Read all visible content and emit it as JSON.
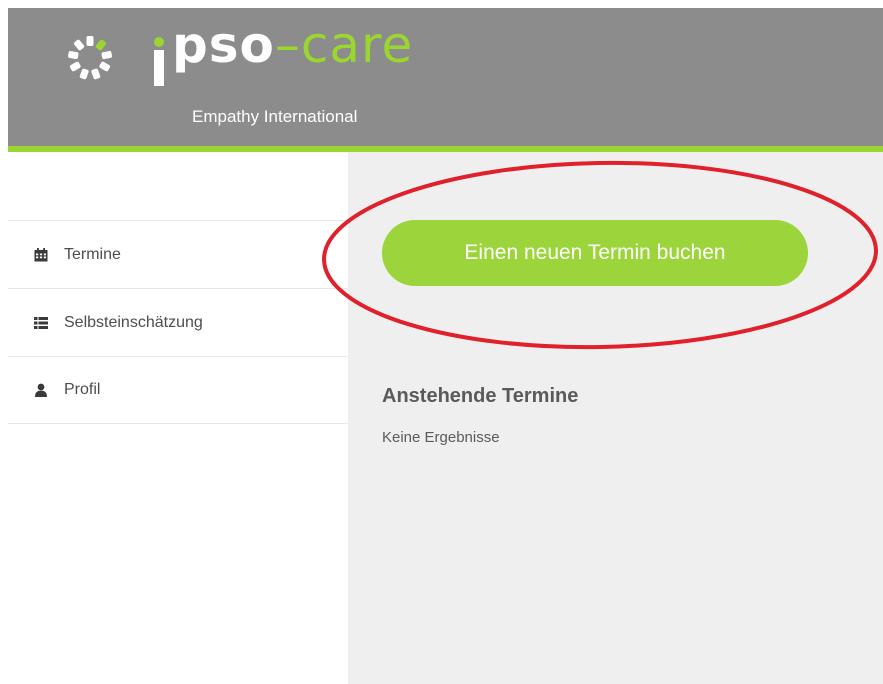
{
  "brand": {
    "logo_icon": "sun-ring-icon",
    "name_part1": "pso",
    "name_part2": "–care",
    "subtitle": "Empathy International",
    "colors": {
      "header_bg": "#8c8c8c",
      "accent": "#9bd530"
    }
  },
  "sidebar": {
    "items": [
      {
        "label": "Termine",
        "icon": "calendar-icon"
      },
      {
        "label": "Selbsteinschätzung",
        "icon": "list-icon"
      },
      {
        "label": "Profil",
        "icon": "user-icon"
      }
    ]
  },
  "main": {
    "book_button_label": "Einen neuen Termin buchen",
    "upcoming_title": "Anstehende Termine",
    "upcoming_empty": "Keine Ergebnisse"
  },
  "annotation": {
    "color": "#e0202a"
  }
}
